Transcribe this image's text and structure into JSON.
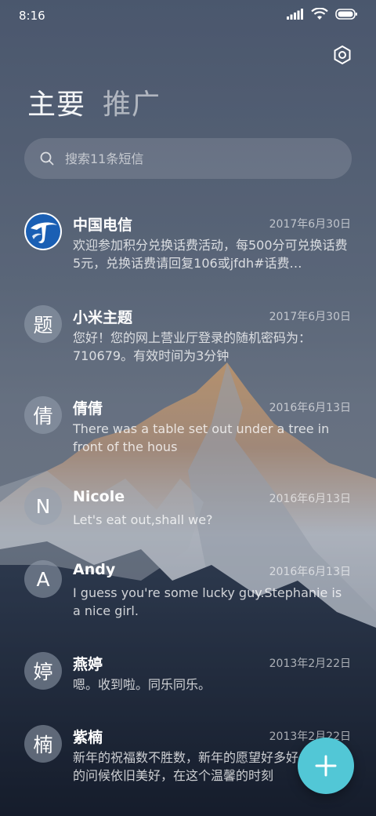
{
  "status_bar": {
    "time": "8:16"
  },
  "tabs": [
    {
      "label": "主要",
      "active": true
    },
    {
      "label": "推广",
      "active": false
    }
  ],
  "search": {
    "placeholder": "搜索11条短信"
  },
  "conversations": [
    {
      "avatar": "",
      "avatar_icon": "china-telecom-logo",
      "sender": "中国电信",
      "date": "2017年6月30日",
      "preview": "欢迎参加积分兑换话费活动，每500分可兑换话费5元，兑换话费请回复106或jfdh#话费…"
    },
    {
      "avatar": "题",
      "sender": "小米主题",
      "date": "2017年6月30日",
      "preview": "您好！您的网上营业厅登录的随机密码为：710679。有效时间为3分钟"
    },
    {
      "avatar": "倩",
      "sender": "倩倩",
      "date": "2016年6月13日",
      "preview": "There was a table set out under a tree in front of the hous"
    },
    {
      "avatar": "N",
      "sender": "Nicole",
      "date": "2016年6月13日",
      "preview": "Let's eat out,shall we?"
    },
    {
      "avatar": "A",
      "sender": "Andy",
      "date": "2016年6月13日",
      "preview": "I guess you're some lucky guy.Stephanie is a nice girl."
    },
    {
      "avatar": "婷",
      "sender": "燕婷",
      "date": "2013年2月22日",
      "preview": "嗯。收到啦。同乐同乐。"
    },
    {
      "avatar": "楠",
      "sender": "紫楠",
      "date": "2013年2月22日",
      "preview": "新年的祝福数不胜数，新年的愿望好多好多，新年的问候依旧美好，在这个温馨的时刻"
    }
  ],
  "icons": {
    "settings": "gear-icon",
    "search": "search-icon",
    "compose": "plus-icon"
  },
  "colors": {
    "fab": "#52c7d6",
    "telecom_blue": "#1a5fb4"
  }
}
